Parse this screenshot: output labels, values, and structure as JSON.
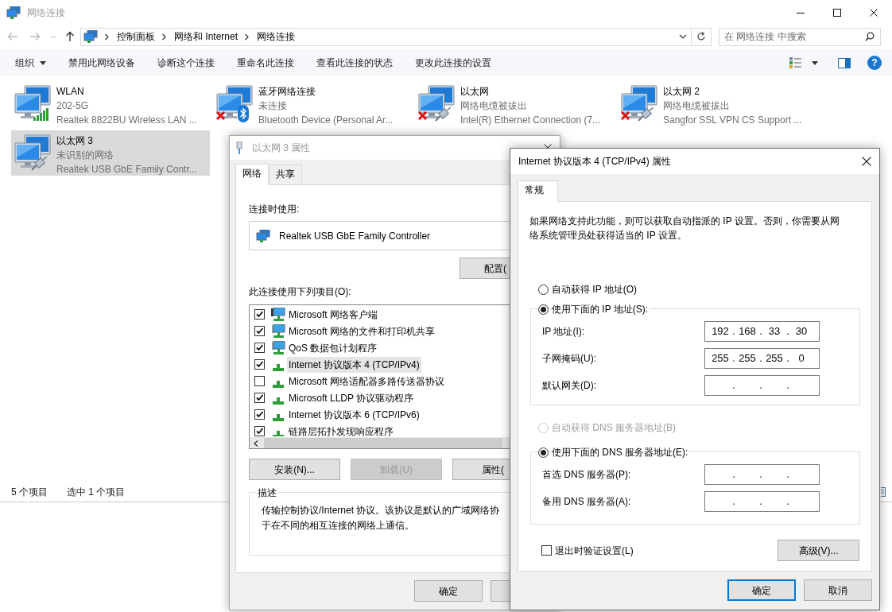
{
  "explorer": {
    "title": "网络连接",
    "breadcrumbs": [
      "控制面板",
      "网络和 Internet",
      "网络连接"
    ],
    "search": {
      "placeholder": "在 网络连接 中搜索"
    },
    "toolbar": [
      {
        "label": "组织",
        "kind": "menu"
      },
      {
        "label": "禁用此网络设备",
        "kind": "command"
      },
      {
        "label": "诊断这个连接",
        "kind": "command"
      },
      {
        "label": "重命名此连接",
        "kind": "command"
      },
      {
        "label": "查看此连接的状态",
        "kind": "command"
      },
      {
        "label": "更改此连接的设置",
        "kind": "command"
      }
    ],
    "help": "?",
    "connections": [
      {
        "name": "WLAN",
        "status": "202-5G",
        "device": "Realtek 8822BU Wireless LAN ...",
        "kind": "wifi",
        "disconnected": false,
        "selected": false
      },
      {
        "name": "蓝牙网络连接",
        "status": "未连接",
        "device": "Bluetooth Device (Personal Ar...",
        "kind": "bluetooth",
        "disconnected": true,
        "selected": false
      },
      {
        "name": "以太网",
        "status": "网络电缆被拔出",
        "device": "Intel(R) Ethernet Connection (7...",
        "kind": "ethernet",
        "disconnected": true,
        "selected": false
      },
      {
        "name": "以太网 2",
        "status": "网络电缆被拔出",
        "device": "Sangfor SSL VPN CS Support ...",
        "kind": "ethernet",
        "disconnected": true,
        "selected": false
      },
      {
        "name": "以太网 3",
        "status": "未识别的网络",
        "device": "Realtek USB GbE Family Contr...",
        "kind": "ethernet",
        "disconnected": false,
        "selected": true
      }
    ],
    "status_bar": {
      "count": "5 个项目",
      "selection": "选中 1 个项目"
    }
  },
  "adapter_dialog": {
    "title": "以太网 3 属性",
    "tabs": [
      {
        "label": "网络",
        "selected": true
      },
      {
        "label": "共享",
        "selected": false
      }
    ],
    "connect_using_label": "连接时使用:",
    "adapter": "Realtek USB GbE Family Controller",
    "configure_button": "配置(",
    "items_label": "此连接使用下列项目(O):",
    "items": [
      {
        "label": "Microsoft 网络客户端",
        "kind": "client",
        "checked": true,
        "selected": false
      },
      {
        "label": "Microsoft 网络的文件和打印机共享",
        "kind": "service",
        "checked": true,
        "selected": false
      },
      {
        "label": "QoS 数据包计划程序",
        "kind": "service",
        "checked": true,
        "selected": false
      },
      {
        "label": "Internet 协议版本 4 (TCP/IPv4)",
        "kind": "protocol",
        "checked": true,
        "selected": true
      },
      {
        "label": "Microsoft 网络适配器多路传送器协议",
        "kind": "protocol",
        "checked": false,
        "selected": false
      },
      {
        "label": "Microsoft LLDP 协议驱动程序",
        "kind": "protocol",
        "checked": true,
        "selected": false
      },
      {
        "label": "Internet 协议版本 6 (TCP/IPv6)",
        "kind": "protocol",
        "checked": true,
        "selected": false
      },
      {
        "label": "链路层拓扑发现响应程序",
        "kind": "protocol",
        "checked": true,
        "selected": false
      }
    ],
    "buttons": [
      {
        "label": "安装(N)...",
        "disabled": false
      },
      {
        "label": "卸载(U)",
        "disabled": true
      },
      {
        "label": "属性(",
        "disabled": false
      }
    ],
    "description": {
      "legend": "描述",
      "lines": [
        "传输控制协议/Internet 协议。该协议是默认的广域网络协",
        "于在不同的相互连接的网络上通信。"
      ]
    },
    "ok_button": "确定"
  },
  "tcpip_dialog": {
    "title": "Internet 协议版本 4 (TCP/IPv4) 属性",
    "tabs": [
      {
        "label": "常规",
        "selected": true
      }
    ],
    "intro": "如果网络支持此功能，则可以获取自动指派的 IP 设置。否则，你需要从网络系统管理员处获得适当的 IP 设置。",
    "ip_mode": [
      {
        "label": "自动获得 IP 地址(O)",
        "selected": false,
        "disabled": false
      },
      {
        "label": "使用下面的 IP 地址(S):",
        "selected": true,
        "disabled": false
      }
    ],
    "ip_fields": [
      {
        "label": "IP 地址(I):",
        "octets": [
          "192",
          "168",
          "33",
          "30"
        ],
        "dots": [
          ".",
          ".",
          "."
        ]
      },
      {
        "label": "子网掩码(U):",
        "octets": [
          "255",
          "255",
          "255",
          "0"
        ],
        "dots": [
          ".",
          ".",
          "."
        ]
      },
      {
        "label": "默认网关(D):",
        "dots": [
          ".",
          ".",
          "."
        ]
      }
    ],
    "dns_mode": [
      {
        "label": "自动获得 DNS 服务器地址(B)",
        "selected": false,
        "disabled": true
      },
      {
        "label": "使用下面的 DNS 服务器地址(E):",
        "selected": true,
        "disabled": false
      }
    ],
    "dns_fields": [
      {
        "label": "首选 DNS 服务器(P):",
        "dots": [
          ".",
          ".",
          "."
        ]
      },
      {
        "label": "备用 DNS 服务器(A):",
        "dots": [
          ".",
          ".",
          "."
        ]
      }
    ],
    "validate": {
      "label": "退出时验证设置(L)",
      "checked": false
    },
    "advanced_button": "高级(V)...",
    "buttons": [
      {
        "label": "确定",
        "default": true
      },
      {
        "label": "取消",
        "default": false
      }
    ]
  }
}
